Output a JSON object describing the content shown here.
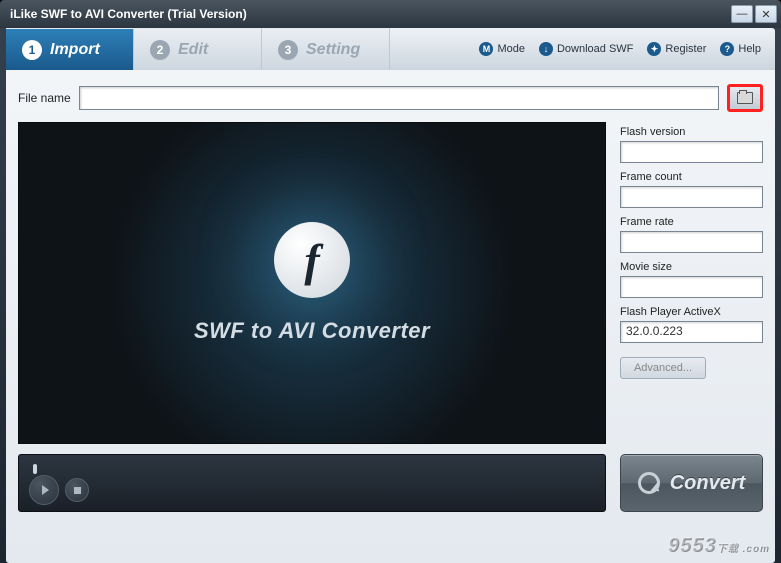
{
  "window": {
    "title": "iLike SWF to AVI Converter (Trial Version)"
  },
  "tabs": [
    {
      "num": "1",
      "label": "Import",
      "active": true
    },
    {
      "num": "2",
      "label": "Edit",
      "active": false
    },
    {
      "num": "3",
      "label": "Setting",
      "active": false
    }
  ],
  "top_links": {
    "mode": "Mode",
    "download": "Download SWF",
    "register": "Register",
    "help": "Help"
  },
  "file": {
    "label": "File name",
    "value": ""
  },
  "info": {
    "flash_version": {
      "label": "Flash version",
      "value": ""
    },
    "frame_count": {
      "label": "Frame count",
      "value": ""
    },
    "frame_rate": {
      "label": "Frame rate",
      "value": ""
    },
    "movie_size": {
      "label": "Movie size",
      "value": ""
    },
    "activex": {
      "label": "Flash Player ActiveX",
      "value": "32.0.0.223"
    }
  },
  "advanced_label": "Advanced...",
  "preview_title": "SWF to AVI Converter",
  "convert_label": "Convert",
  "watermark": "9553",
  "watermark_suffix": "下载 .com"
}
